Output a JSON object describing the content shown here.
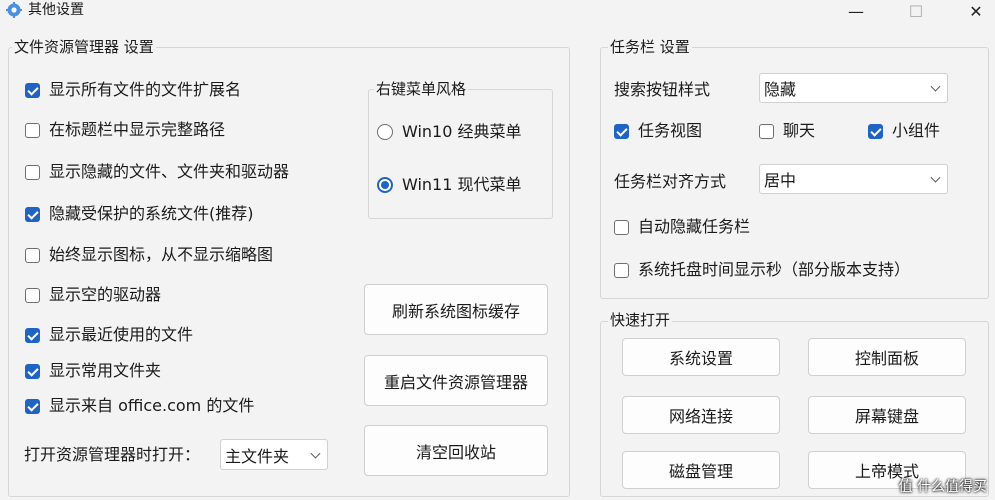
{
  "window": {
    "title": "其他设置",
    "icon": "gear-icon",
    "minimize": "—",
    "maximize": "☐",
    "close": "✕"
  },
  "explorer": {
    "group_label": "文件资源管理器 设置",
    "options": [
      {
        "label": "显示所有文件的文件扩展名",
        "checked": true
      },
      {
        "label": "在标题栏中显示完整路径",
        "checked": false
      },
      {
        "label": "显示隐藏的文件、文件夹和驱动器",
        "checked": false
      },
      {
        "label": "隐藏受保护的系统文件(推荐)",
        "checked": true
      },
      {
        "label": "始终显示图标，从不显示缩略图",
        "checked": false
      },
      {
        "label": "显示空的驱动器",
        "checked": false
      },
      {
        "label": "显示最近使用的文件",
        "checked": true
      },
      {
        "label": "显示常用文件夹",
        "checked": true
      },
      {
        "label": "显示来自 office.com 的文件",
        "checked": true
      }
    ],
    "open_label": "打开资源管理器时打开：",
    "open_value": "主文件夹",
    "context_menu": {
      "label": "右键菜单风格",
      "options": [
        {
          "label": "Win10 经典菜单",
          "selected": false
        },
        {
          "label": "Win11 现代菜单",
          "selected": true
        }
      ]
    },
    "buttons": {
      "refresh": "刷新系统图标缓存",
      "restart": "重启文件资源管理器",
      "empty": "清空回收站"
    }
  },
  "taskbar": {
    "group_label": "任务栏 设置",
    "search_label": "搜索按钮样式",
    "search_value": "隐藏",
    "items": [
      {
        "label": "任务视图",
        "checked": true
      },
      {
        "label": "聊天",
        "checked": false
      },
      {
        "label": "小组件",
        "checked": true
      }
    ],
    "align_label": "任务栏对齐方式",
    "align_value": "居中",
    "autohide": {
      "label": "自动隐藏任务栏",
      "checked": false
    },
    "seconds": {
      "label": "系统托盘时间显示秒（部分版本支持）",
      "checked": false
    }
  },
  "quick": {
    "group_label": "快速打开",
    "buttons": [
      "系统设置",
      "控制面板",
      "网络连接",
      "屏幕键盘",
      "磁盘管理",
      "上帝模式"
    ]
  },
  "watermark": "值 什么值得买",
  "colors": {
    "accent": "#1f64c4",
    "background": "#f3f3f3"
  }
}
